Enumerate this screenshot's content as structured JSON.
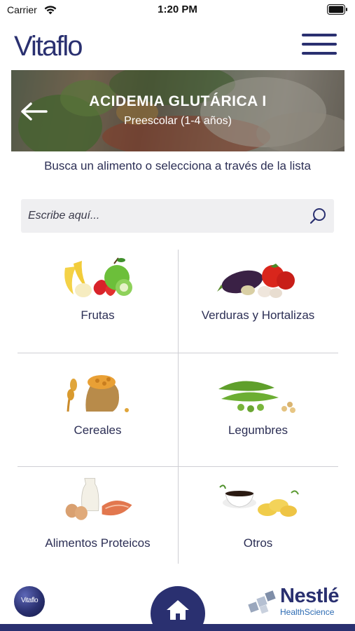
{
  "status_bar": {
    "carrier": "Carrier",
    "time": "1:20 PM"
  },
  "header": {
    "logo": "Vitaflo",
    "menu_icon": "hamburger-menu-icon"
  },
  "banner": {
    "title": "ACIDEMIA GLUTÁRICA I",
    "subtitle": "Preescolar (1-4 años)",
    "back_icon": "arrow-left-icon"
  },
  "instructions": "Busca un alimento o selecciona a través de la lista",
  "search": {
    "placeholder": "Escribe aquí...",
    "icon": "search-icon"
  },
  "categories": [
    {
      "label": "Frutas",
      "icon": "fruits-icon"
    },
    {
      "label": "Verduras y Hortalizas",
      "icon": "vegetables-icon"
    },
    {
      "label": "Cereales",
      "icon": "cereals-icon"
    },
    {
      "label": "Legumbres",
      "icon": "legumes-icon"
    },
    {
      "label": "Alimentos Proteicos",
      "icon": "protein-foods-icon"
    },
    {
      "label": "Otros",
      "icon": "others-icon"
    }
  ],
  "footer": {
    "badge_text": "Vitaflo",
    "home_icon": "home-icon",
    "brand_name": "Nestlé",
    "brand_sub": "HealthScience"
  },
  "colors": {
    "brand": "#2a3070",
    "text": "#2c2f55",
    "search_bg": "#efeff1",
    "divider": "#cfcfd4"
  }
}
